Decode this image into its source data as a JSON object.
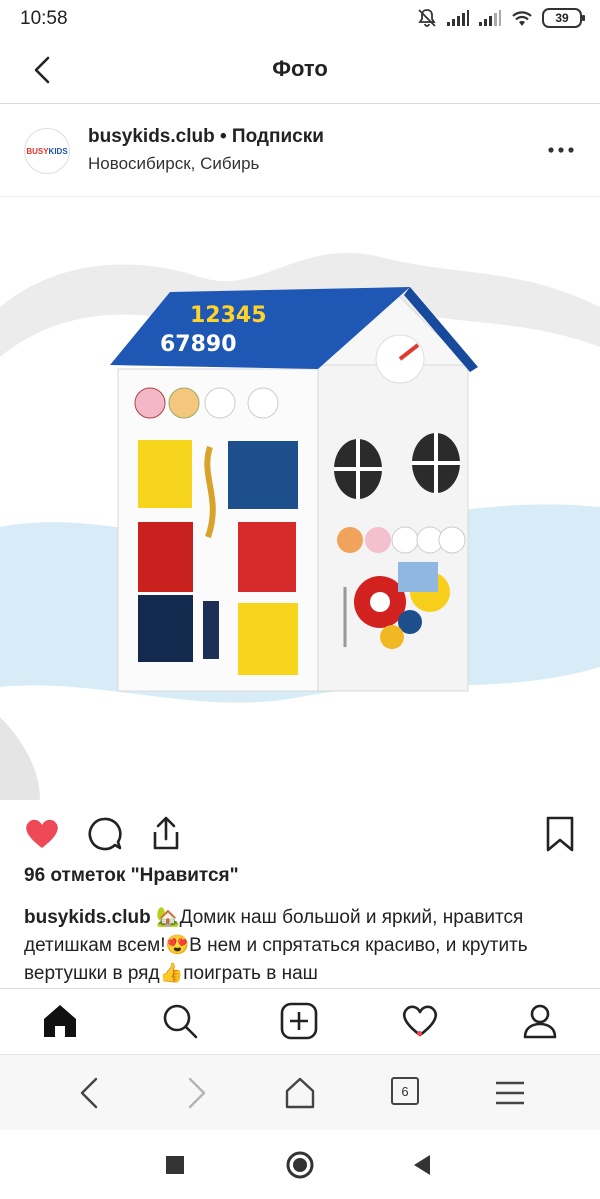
{
  "status": {
    "time": "10:58",
    "battery": "39"
  },
  "header": {
    "title": "Фото"
  },
  "post": {
    "username": "busykids.club",
    "separator": " • ",
    "follow_state": "Подписки",
    "location": "Новосибирск, Сибирь",
    "avatar_text_1": "BUSY",
    "avatar_text_2": "KIDS",
    "photo": {
      "roof_numbers_row1": "12345",
      "roof_numbers_row2": "67890"
    },
    "likes_text": "96 отметок \"Нравится\"",
    "caption_user": "busykids.club",
    "caption_text": " 🏡Домик наш большой и яркий, нравится детишкам всем!😍В нем и спрятаться красиво, и крутить вертушки в ряд👍поиграть в наш"
  },
  "browser": {
    "tab_count": "6"
  },
  "colors": {
    "like_red": "#ed4956",
    "roof_blue": "#1f57b5",
    "text": "#222222"
  }
}
